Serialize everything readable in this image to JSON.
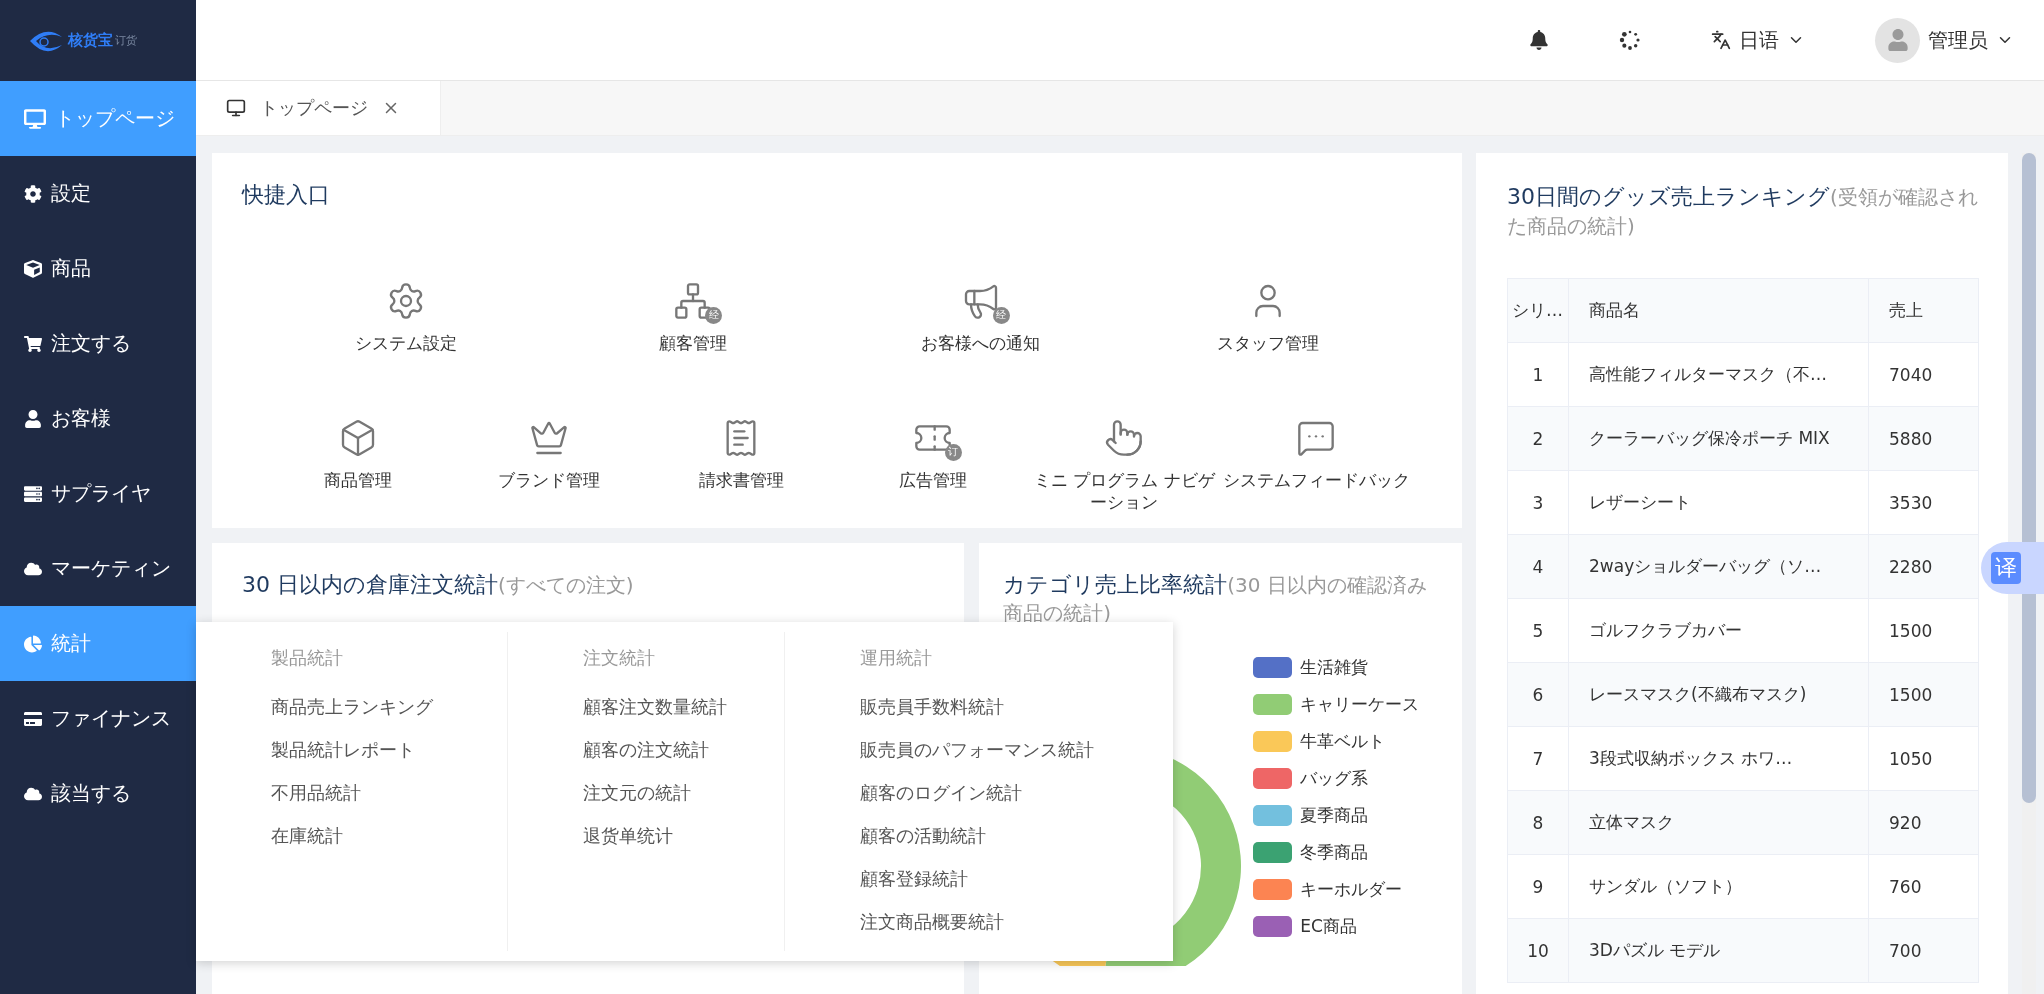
{
  "logo": {
    "name": "核货宝",
    "suffix": "订货"
  },
  "sidebar": {
    "items": [
      {
        "label": "トップページ",
        "selected": true
      },
      {
        "label": "設定",
        "selected": false
      },
      {
        "label": "商品",
        "selected": false
      },
      {
        "label": "注文する",
        "selected": false
      },
      {
        "label": "お客様",
        "selected": false
      },
      {
        "label": "サプライヤ",
        "selected": false
      },
      {
        "label": "マーケティン",
        "selected": false
      },
      {
        "label": "統計",
        "selected": true
      },
      {
        "label": "ファイナンス",
        "selected": false
      },
      {
        "label": "該当する",
        "selected": false
      }
    ]
  },
  "header": {
    "language": "日语",
    "user": "管理员"
  },
  "tabs": [
    {
      "label": "トップページ",
      "selected": true
    }
  ],
  "quick_entry": {
    "title": "快捷入口",
    "items": [
      {
        "label": "システム設定"
      },
      {
        "label": "顧客管理",
        "badge": "经"
      },
      {
        "label": "お客様への通知",
        "badge": "经"
      },
      {
        "label": "スタッフ管理"
      },
      {
        "label": "商品管理"
      },
      {
        "label": "ブランド管理"
      },
      {
        "label": "請求書管理"
      },
      {
        "label": "広告管理",
        "badge": "订"
      },
      {
        "label": "ミニ プログラム ナビゲーション"
      },
      {
        "label": "システムフィードバック"
      }
    ]
  },
  "warehouse_card": {
    "title": "30 日以内の倉庫注文統計",
    "note": "(すべての注文)"
  },
  "category_card": {
    "title": "カテゴリ売上比率統計",
    "note": "(30 日以内の確認済み商品の統計)",
    "legend": [
      {
        "label": "生活雑貨",
        "color": "#5470c6"
      },
      {
        "label": "キャリーケース",
        "color": "#91cc75"
      },
      {
        "label": "牛革ベルト",
        "color": "#fac858"
      },
      {
        "label": "バッグ系",
        "color": "#ee6666"
      },
      {
        "label": "夏季商品",
        "color": "#73c0de"
      },
      {
        "label": "冬季商品",
        "color": "#3ba272"
      },
      {
        "label": "キーホルダー",
        "color": "#fc8452"
      },
      {
        "label": "EC商品",
        "color": "#9a60b4"
      }
    ]
  },
  "ranking": {
    "title": "30日間のグッズ売上ランキング",
    "note": "(受領が確認された商品の統計)",
    "columns": [
      "シリ…",
      "商品名",
      "売上"
    ],
    "rows": [
      [
        "1",
        "高性能フィルターマスク（不…",
        "7040"
      ],
      [
        "2",
        "クーラーバッグ保冷ポーチ MIX",
        "5880"
      ],
      [
        "3",
        "レザーシート",
        "3530"
      ],
      [
        "4",
        "2wayショルダーバッグ（ソ…",
        "2280"
      ],
      [
        "5",
        "ゴルフクラブカバー",
        "1500"
      ],
      [
        "6",
        "レースマスク(不織布マスク)",
        "1500"
      ],
      [
        "7",
        "3段式収納ボックス ホワ…",
        "1050"
      ],
      [
        "8",
        "立体マスク",
        "920"
      ],
      [
        "9",
        "サンダル（ソフト）",
        "760"
      ],
      [
        "10",
        "3Dパズル モデル",
        "700"
      ]
    ]
  },
  "stats_menu": [
    {
      "title": "製品統計",
      "items": [
        "商品売上ランキング",
        "製品統計レポート",
        "不用品統計",
        "在庫統計"
      ]
    },
    {
      "title": "注文統計",
      "items": [
        "顧客注文数量統計",
        "顧客の注文統計",
        "注文元の統計",
        "退货单统计"
      ]
    },
    {
      "title": "運用統計",
      "items": [
        "販売員手数料統計",
        "販売員のパフォーマンス統計",
        "顧客のログイン統計",
        "顧客の活動統計",
        "顧客登録統計",
        "注文商品概要統計"
      ]
    }
  ],
  "translate_button": "译"
}
